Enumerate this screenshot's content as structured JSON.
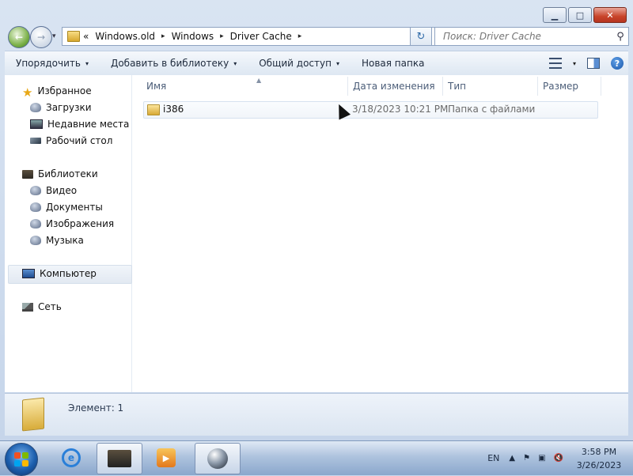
{
  "window": {
    "caption_buttons": {
      "minimize": "▁",
      "maximize": "□",
      "close": "✕"
    }
  },
  "nav": {
    "back_glyph": "←",
    "dropdown_glyph": "▾",
    "breadcrumb_overflow": "«",
    "breadcrumb": [
      "Windows.old",
      "Windows",
      "Driver Cache"
    ],
    "separator": "▸",
    "refresh_glyph": "↻",
    "search_placeholder": "Поиск: Driver Cache",
    "search_icon": "⚲"
  },
  "toolbar": {
    "items": [
      "Упорядочить",
      "Добавить в библиотеку",
      "Общий доступ",
      "Новая папка"
    ],
    "dropdown_glyph": "▾",
    "help_glyph": "?"
  },
  "sidebar": {
    "favorites_label": "Избранное",
    "favorites": [
      "Загрузки",
      "Недавние места",
      "Рабочий стол"
    ],
    "libraries_label": "Библиотеки",
    "libraries": [
      "Видео",
      "Документы",
      "Изображения",
      "Музыка"
    ],
    "computer_label": "Компьютер",
    "network_label": "Сеть"
  },
  "file_list": {
    "columns": [
      "Имя",
      "Дата изменения",
      "Тип",
      "Размер"
    ],
    "rows": [
      {
        "name": "i386",
        "modified": "3/18/2023 10:21 PM",
        "type": "Папка с файлами",
        "size": ""
      }
    ]
  },
  "details": {
    "text": "Элемент: 1"
  },
  "taskbar": {
    "language": "EN",
    "tray_icons": [
      "▲",
      "⚑",
      "▣",
      "🔇"
    ],
    "time": "3:58 PM",
    "date": "3/26/2023",
    "ie_glyph": "e",
    "wmp_glyph": "▶"
  },
  "colors": {
    "flag_red": "#f25022",
    "flag_green": "#7fba00",
    "flag_blue": "#00a4ef",
    "flag_yellow": "#ffb900"
  }
}
